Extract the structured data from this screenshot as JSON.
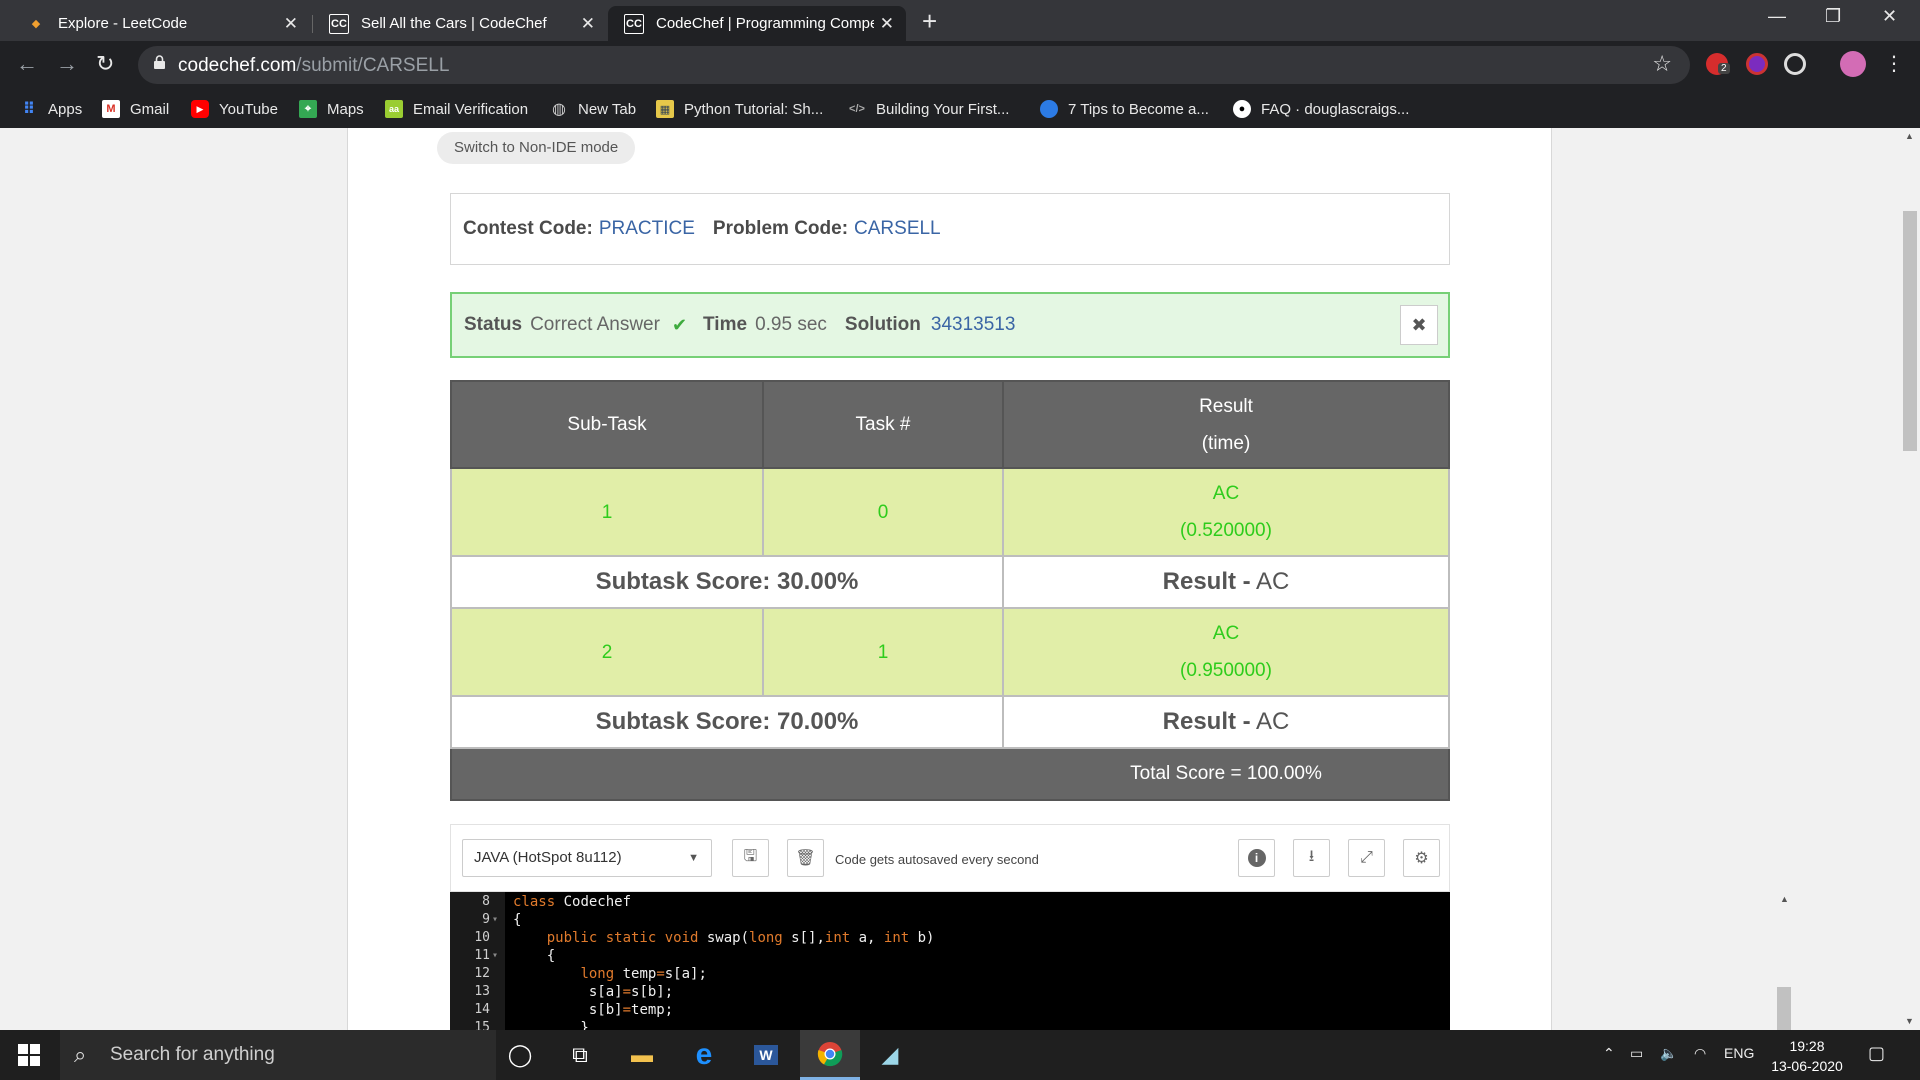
{
  "browser": {
    "tabs": [
      {
        "title": "Explore - LeetCode",
        "active": false
      },
      {
        "title": "Sell All the Cars | CodeChef",
        "active": false
      },
      {
        "title": "CodeChef | Programming Compe",
        "active": true
      }
    ],
    "url_domain": "codechef.com",
    "url_path": "/submit/CARSELL",
    "extension_badge": "2"
  },
  "bookmarks": [
    {
      "label": "Apps",
      "icon": "apps-grid-icon"
    },
    {
      "label": "Gmail",
      "icon": "gmail-icon"
    },
    {
      "label": "YouTube",
      "icon": "youtube-icon"
    },
    {
      "label": "Maps",
      "icon": "maps-icon"
    },
    {
      "label": "Email Verification",
      "icon": "email-verification-icon"
    },
    {
      "label": "New Tab",
      "icon": "globe-icon"
    },
    {
      "label": "Python Tutorial: Sh...",
      "icon": "python-tutorial-icon"
    },
    {
      "label": "Building Your First...",
      "icon": "code-icon"
    },
    {
      "label": "7 Tips to Become a...",
      "icon": "blue-circle-icon"
    },
    {
      "label": "FAQ · douglascraigs...",
      "icon": "github-icon"
    }
  ],
  "page": {
    "switch_button": "Switch to Non-IDE mode",
    "contest_label": "Contest Code:",
    "contest_code": "PRACTICE",
    "problem_label": "Problem Code:",
    "problem_code": "CARSELL",
    "status": {
      "status_label": "Status",
      "status_value": "Correct Answer",
      "time_label": "Time",
      "time_value": "0.95 sec",
      "solution_label": "Solution",
      "solution_value": "34313513"
    },
    "table": {
      "headers": [
        "Sub-Task",
        "Task #",
        "Result",
        "(time)"
      ],
      "rows": [
        {
          "subtask": "1",
          "task": "0",
          "result": "AC",
          "time": "(0.520000)"
        },
        {
          "subtask": "2",
          "task": "1",
          "result": "AC",
          "time": "(0.950000)"
        }
      ],
      "scores": [
        {
          "score": "Subtask Score: 30.00%",
          "result_label": "Result -",
          "result": "AC"
        },
        {
          "score": "Subtask Score: 70.00%",
          "result_label": "Result -",
          "result": "AC"
        }
      ],
      "total": "Total Score = 100.00%"
    },
    "editor": {
      "language": "JAVA (HotSpot 8u112)",
      "autosave_text": "Code gets autosaved every second",
      "lines": [
        {
          "n": "8",
          "fold": "",
          "code": "class Codechef"
        },
        {
          "n": "9",
          "fold": "▾",
          "code": "{"
        },
        {
          "n": "10",
          "fold": "",
          "code": "    public static void swap(long s[],int a, int b)"
        },
        {
          "n": "11",
          "fold": "▾",
          "code": "    {"
        },
        {
          "n": "12",
          "fold": "",
          "code": "        long temp=s[a];"
        },
        {
          "n": "13",
          "fold": "",
          "code": "         s[a]=s[b];"
        },
        {
          "n": "14",
          "fold": "",
          "code": "         s[b]=temp;"
        },
        {
          "n": "15",
          "fold": "",
          "code": "        }"
        }
      ]
    }
  },
  "taskbar": {
    "search_placeholder": "Search for anything",
    "language": "ENG",
    "time": "19:28",
    "date": "13-06-2020"
  }
}
